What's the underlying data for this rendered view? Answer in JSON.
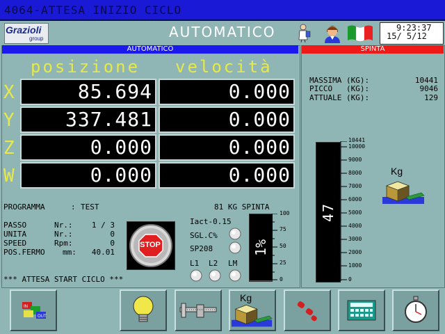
{
  "message_bar": {
    "text": "4064-ATTESA INIZIO CICLO"
  },
  "header": {
    "logo_text": "Grazioli",
    "logo_sub": "group",
    "mode": "AUTOMATICO",
    "time": "9:23:37",
    "date": "15/ 5/12"
  },
  "auto_panel": {
    "title": "AUTOMATICO",
    "col_position": "posizione",
    "col_speed": "velocità",
    "axes": [
      {
        "name": "X",
        "position": "85.694",
        "speed": "0.000"
      },
      {
        "name": "Y",
        "position": "337.481",
        "speed": "0.000"
      },
      {
        "name": "Z",
        "position": "0.000",
        "speed": "0.000"
      },
      {
        "name": "W",
        "position": "0.000",
        "speed": "0.000"
      }
    ],
    "program_label": "PROGRAMMA",
    "program_sep": ":",
    "program_value": "TEST",
    "spinta_kg": "81 KG SPINTA",
    "params": [
      {
        "label": "PASSO",
        "unit": "Nr.:",
        "value": "1 / 3"
      },
      {
        "label": "UNITA",
        "unit": "Nr.:",
        "value": "0"
      },
      {
        "label": "SPEED",
        "unit": "Rpm:",
        "value": "0"
      },
      {
        "label": "POS.FERMO",
        "unit": "mm:",
        "value": "40.01"
      }
    ],
    "iact": "Iact-0.15",
    "sgl": "SGL.C%",
    "sp208": "SP208",
    "l1": "L1",
    "l2": "L2",
    "lm": "LM",
    "percent_value": "1%",
    "percent_level": 0.01,
    "percent_ticks": [
      "100",
      "75",
      "50",
      "25",
      "0"
    ],
    "stop_label": "STOP",
    "status": "*** ATTESA START CICLO ***"
  },
  "spinta_panel": {
    "title": "SPINTA",
    "rows": [
      {
        "label": "MASSIMA (KG):",
        "value": "10441"
      },
      {
        "label": "PICCO   (KG):",
        "value": "9046"
      },
      {
        "label": "ATTUALE (KG):",
        "value": "129"
      }
    ],
    "bar_value": "47",
    "bar_level": 0.0,
    "scale_max": "10441",
    "scale_ticks": [
      "10000",
      "9000",
      "8000",
      "7000",
      "6000",
      "5000",
      "4000",
      "3000",
      "2000",
      "1000",
      "0"
    ],
    "weight_label": "Kg"
  },
  "toolbar": {
    "buttons": [
      {
        "name": "io-button",
        "label": "IN OUT"
      },
      {
        "name": "lamp-button",
        "label": ""
      },
      {
        "name": "caliper-button",
        "label": ""
      },
      {
        "name": "weight-button",
        "label": "Kg"
      },
      {
        "name": "tools-button",
        "label": ""
      },
      {
        "name": "calculator-button",
        "label": ""
      },
      {
        "name": "timer-button",
        "label": ""
      }
    ]
  }
}
